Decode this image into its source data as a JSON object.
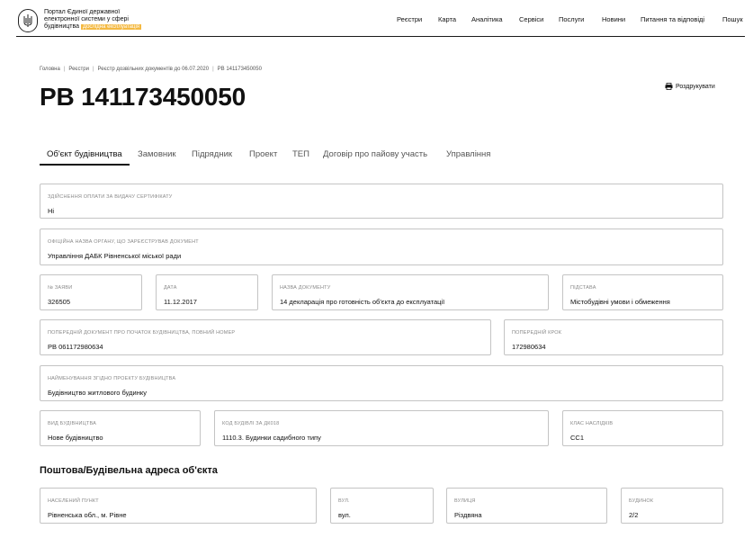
{
  "header": {
    "portal_title_1": "Портал Єдиної державної",
    "portal_title_2": "електронної системи у сфері",
    "portal_title_3": "будівництва",
    "badge": "Дослідна експлуатація",
    "nav": [
      {
        "label": "Реєстри"
      },
      {
        "label": "Карта"
      },
      {
        "label": "Аналітика"
      },
      {
        "label": "Сервіси"
      },
      {
        "label": "Послуги"
      },
      {
        "label": "Новини"
      },
      {
        "label": "Питання та відповіді"
      },
      {
        "label": "Пошук"
      }
    ]
  },
  "breadcrumb": [
    "Головна",
    "Реєстри",
    "Реєстр дозвільних документів до 06.07.2020",
    "РВ 141173450050"
  ],
  "document": {
    "title": "РВ 141173450050",
    "print_label": "Роздрукувати"
  },
  "tabs": [
    {
      "label": "Об'єкт будівництва"
    },
    {
      "label": "Замовник"
    },
    {
      "label": "Підрядник"
    },
    {
      "label": "Проект"
    },
    {
      "label": "ТЕП"
    },
    {
      "label": "Договір про пайову участь"
    },
    {
      "label": "Управління"
    }
  ],
  "fields": {
    "payment": {
      "label": "Здійснення оплати за видачу сертифікату",
      "value": "Ні"
    },
    "authority": {
      "label": "Офіційна назва органу, що зареєстрував документ",
      "value": "Управління ДАБК Рівненської міської ради"
    },
    "application_no": {
      "label": "№ заяви",
      "value": "326505"
    },
    "date": {
      "label": "Дата",
      "value": "11.12.2017"
    },
    "doc_name": {
      "label": "Назва документу",
      "value": "14 декларація про готовність об'єкта до експлуатації"
    },
    "basis": {
      "label": "Підстава",
      "value": "Містобудівні умови і обмеження"
    },
    "prev_doc": {
      "label": "Попередній документ про початок будівництва, повний номер",
      "value": "РВ 061172980634"
    },
    "prev_step": {
      "label": "Попередній крок",
      "value": "172980634"
    },
    "project_name": {
      "label": "Найменування згідно проекту будівництва",
      "value": "Будівництво житлового будинку"
    },
    "construction_type": {
      "label": "Вид будівництва",
      "value": "Нове будівництво"
    },
    "building_code": {
      "label": "Код будівлі за ДК018",
      "value": "1110.3. Будинки садибного типу"
    },
    "consequence_class": {
      "label": "Клас наслідків",
      "value": "СС1"
    }
  },
  "address": {
    "title": "Поштова/Будівельна адреса об'єкта",
    "settlement": {
      "label": "Населений пункт",
      "value": "Рівненська обл., м. Рівне"
    },
    "street_type": {
      "label": "Вул.",
      "value": "вул."
    },
    "street": {
      "label": "Вулиця",
      "value": "Різдвяна"
    },
    "building": {
      "label": "Будинок",
      "value": "2/2"
    }
  }
}
